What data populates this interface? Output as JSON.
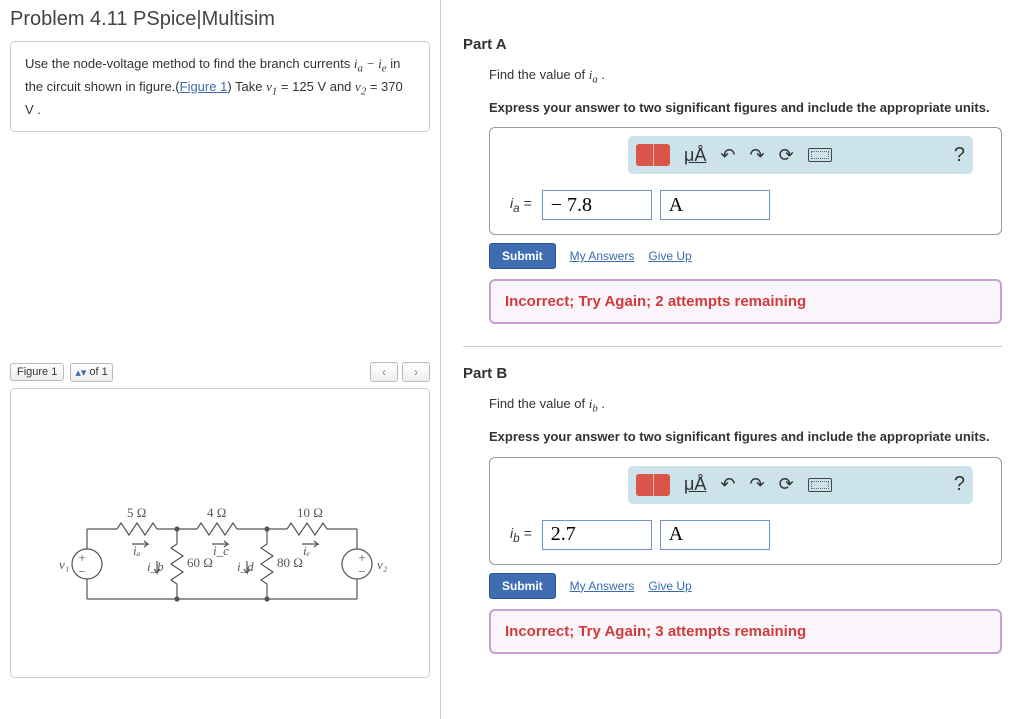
{
  "problem": {
    "title": "Problem 4.11 PSpice|Multisim",
    "text1": "Use the node-voltage method to find the branch currents ",
    "text2": " in the circuit shown in figure.(",
    "figureLinkText": "Figure 1",
    "text3": ") Take ",
    "v1": " = 125 ",
    "vunit": "V",
    "text4": " and ",
    "v2": " = 370 ",
    "text5": " ."
  },
  "figureNav": {
    "label": "Figure 1",
    "of": "of 1"
  },
  "circuit": {
    "r1": "5 Ω",
    "r2": "4 Ω",
    "r3": "10 Ω",
    "r4": "60 Ω",
    "r5": "80 Ω",
    "v1": "v₁",
    "v2": "v₂",
    "ia": "iₐ",
    "ib": "i_b",
    "ic": "i_c",
    "id": "i_d",
    "ie": "iₑ"
  },
  "partA": {
    "title": "Part A",
    "prompt": "Find the value of ",
    "var": "iₐ",
    "instr": "Express your answer to two significant figures and include the appropriate units.",
    "eqLabel": "iₐ =",
    "value": "− 7.8",
    "unit": "A",
    "submit": "Submit",
    "myAnswers": "My Answers",
    "giveUp": "Give Up",
    "feedback": "Incorrect; Try Again; 2 attempts remaining",
    "unitsBtn": "μÅ"
  },
  "partB": {
    "title": "Part B",
    "prompt": "Find the value of ",
    "var": "i_b",
    "instr": "Express your answer to two significant figures and include the appropriate units.",
    "eqLabel": "i_b =",
    "value": "2.7",
    "unit": "A",
    "submit": "Submit",
    "myAnswers": "My Answers",
    "giveUp": "Give Up",
    "feedback": "Incorrect; Try Again; 3 attempts remaining",
    "unitsBtn": "μÅ"
  }
}
